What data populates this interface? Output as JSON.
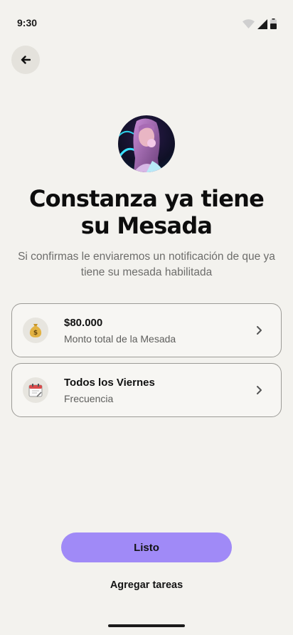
{
  "status_bar": {
    "time": "9:30"
  },
  "header": {
    "back_icon": "arrow-left-icon"
  },
  "profile": {
    "avatar": "avatar",
    "title": "Constanza ya tiene su Mesada",
    "subtitle": "Si confirmas le enviaremos un notificación de que ya tiene su mesada habilitada"
  },
  "cards": [
    {
      "icon": "money-bag-icon",
      "title": "$80.000",
      "subtitle": "Monto total de la Mesada"
    },
    {
      "icon": "calendar-icon",
      "title": "Todos los Viernes",
      "subtitle": "Frecuencia"
    }
  ],
  "actions": {
    "primary_label": "Listo",
    "secondary_label": "Agregar tareas",
    "primary_color": "#a08af7"
  },
  "colors": {
    "background": "#f3f2ee",
    "card_border": "#9c9b97"
  }
}
